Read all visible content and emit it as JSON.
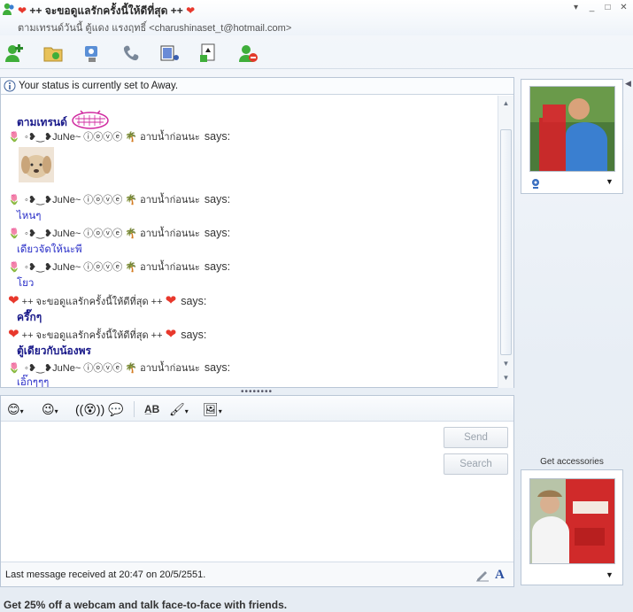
{
  "window": {
    "title": "++ จะขอดูแลรักครั้งนี้ให้ดีที่สุด ++",
    "subtitle": "ตามเทรนด์วันนี้ ตู้แดง แรงฤทธิ์ <charushinaset_t@hotmail.com>",
    "minimize_label": "_",
    "restore_label": "□",
    "close_label": "✕",
    "menu_label": "▾"
  },
  "status": {
    "text": "Your status is currently set to Away."
  },
  "messages": [
    {
      "kind": "text",
      "text": "ตามเทรนด์",
      "style": "bold"
    },
    {
      "kind": "speaker",
      "name": " ◦❥‿❥JuNe~ ⓘⓞⓥⓔ",
      "suffix": "อาบน้ำก่อนนะ",
      "says": "says:"
    },
    {
      "kind": "speaker",
      "name": " ◦❥‿❥JuNe~ ⓘⓞⓥⓔ",
      "suffix": "อาบน้ำก่อนนะ",
      "says": "says:"
    },
    {
      "kind": "text",
      "text": "ไหนๆ",
      "style": "normal"
    },
    {
      "kind": "speaker",
      "name": " ◦❥‿❥JuNe~ ⓘⓞⓥⓔ",
      "suffix": "อาบน้ำก่อนนะ",
      "says": "says:"
    },
    {
      "kind": "text",
      "text": "เดียวจัดให้นะพี",
      "style": "normal"
    },
    {
      "kind": "speaker",
      "name": " ◦❥‿❥JuNe~ ⓘⓞⓥⓔ",
      "suffix": "อาบน้ำก่อนนะ",
      "says": "says:"
    },
    {
      "kind": "text",
      "text": "โยว",
      "style": "normal"
    },
    {
      "kind": "speaker",
      "name": "++ จะขอดูแลรักครั้งนี้ให้ดีที่สุด ++",
      "suffix": "",
      "says": "says:"
    },
    {
      "kind": "text",
      "text": "ครึ๊กๆ",
      "style": "bold"
    },
    {
      "kind": "speaker",
      "name": "++ จะขอดูแลรักครั้งนี้ให้ดีที่สุด ++",
      "suffix": "",
      "says": "says:"
    },
    {
      "kind": "text",
      "text": "ตู้เดียวกับน้องพร",
      "style": "bold"
    },
    {
      "kind": "speaker",
      "name": " ◦❥‿❥JuNe~ ⓘⓞⓥⓔ",
      "suffix": "อาบน้ำก่อนนะ",
      "says": "says:"
    },
    {
      "kind": "text",
      "text": "เอิ๊กๆๆๆ",
      "style": "normal"
    }
  ],
  "edit_toolbar": {
    "font_label": "A̲B",
    "grip": "••••••••"
  },
  "buttons": {
    "send": "Send",
    "search": "Search"
  },
  "footer": {
    "last_message": "Last message received at 20:47 on 20/5/2551.",
    "get_accessories": "Get accessories",
    "ad": "Get 25% off a webcam and talk face-to-face with friends."
  },
  "colors": {
    "accent_blue": "#2a2fc8",
    "heart_red": "#e8382c",
    "border": "#b9c6d6"
  }
}
